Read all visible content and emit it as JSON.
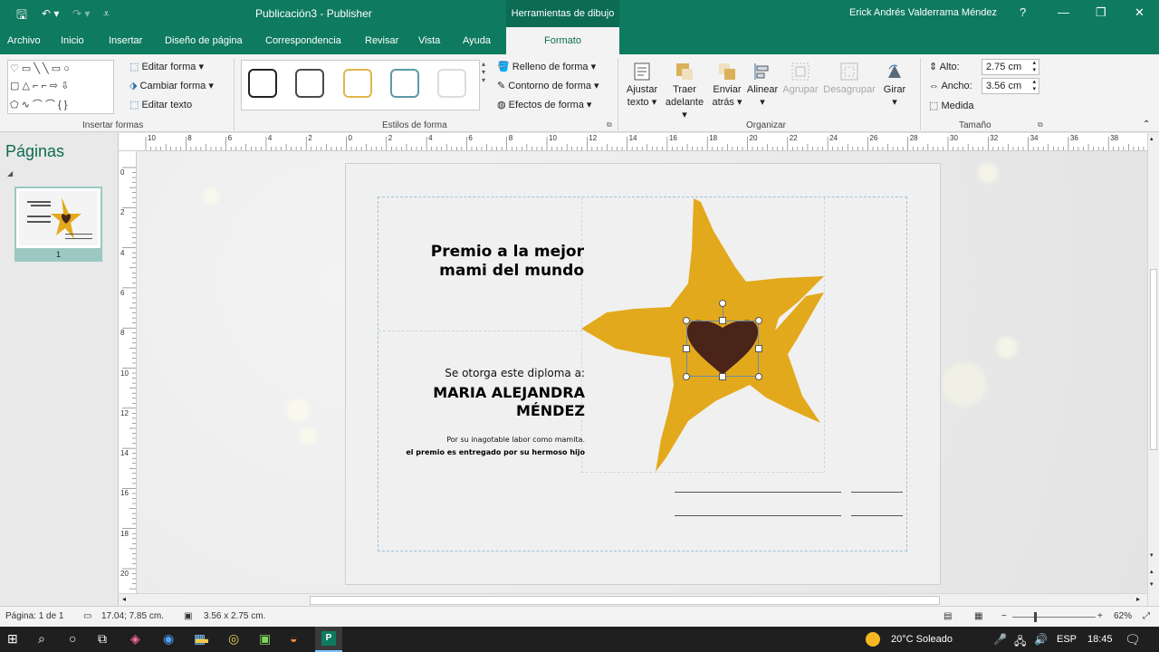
{
  "window": {
    "document_title": "Publicación3  -  Publisher",
    "context_tab_header": "Herramientas de dibujo",
    "user_name": "Erick Andrés Valderrama Méndez",
    "help": "?",
    "minimize": "—",
    "restore": "❐",
    "close": "✕"
  },
  "tabs": [
    "Archivo",
    "Inicio",
    "Insertar",
    "Diseño de página",
    "Correspondencia",
    "Revisar",
    "Vista",
    "Ayuda"
  ],
  "active_tab": "Formato",
  "ribbon": {
    "insert_shapes": {
      "label": "Insertar formas",
      "edit_shape": "Editar forma",
      "change_shape": "Cambiar forma",
      "edit_text": "Editar texto"
    },
    "shape_styles": {
      "label": "Estilos de forma",
      "fill": "Relleno de forma",
      "outline": "Contorno de forma",
      "effects": "Efectos de forma",
      "swatch_colors": [
        "#222222",
        "#4a4a4a",
        "#e0b64a",
        "#5b9aa8",
        "#dcdcdc"
      ]
    },
    "arrange": {
      "label": "Organizar",
      "wrap_text": [
        "Ajustar",
        "texto"
      ],
      "bring_forward": [
        "Traer",
        "adelante"
      ],
      "send_backward": [
        "Enviar",
        "atrás"
      ],
      "align": "Alinear",
      "group": "Agrupar",
      "ungroup": "Desagrupar",
      "rotate": "Girar"
    },
    "size": {
      "label": "Tamaño",
      "height_label": "Alto:",
      "height_value": "2.75 cm",
      "width_label": "Ancho:",
      "width_value": "3.56 cm",
      "measure": "Medida"
    }
  },
  "pages_panel": {
    "title": "Páginas",
    "page_number": "1"
  },
  "ruler": {
    "horizontal": [
      "10",
      "8",
      "6",
      "4",
      "2",
      "0",
      "2",
      "4",
      "6",
      "8",
      "10",
      "12",
      "14",
      "16",
      "18",
      "20",
      "22",
      "24",
      "26",
      "28",
      "30",
      "32",
      "34",
      "36",
      "38"
    ],
    "vertical": [
      "0",
      "2",
      "4",
      "6",
      "8",
      "10",
      "12",
      "14",
      "16",
      "18",
      "20"
    ]
  },
  "diploma": {
    "title": [
      "Premio  a la mejor",
      "mami del mundo"
    ],
    "granted": "Se otorga este diploma a:",
    "recipient": [
      "MARIA ALEJANDRA",
      "MÉNDEZ"
    ],
    "reason": "Por su inagotable labor como mamita.",
    "given_by": "el premio es entregado por su hermoso hijo",
    "star_color": "#e3a91c",
    "heart_color": "#4a2418"
  },
  "status": {
    "page": "Página: 1 de 1",
    "position": "17.04; 7.85 cm.",
    "size": "3.56 x  2.75 cm.",
    "zoom": "62%"
  },
  "taskbar": {
    "weather": "20°C  Soleado",
    "language": "ESP",
    "time": "18:45"
  }
}
